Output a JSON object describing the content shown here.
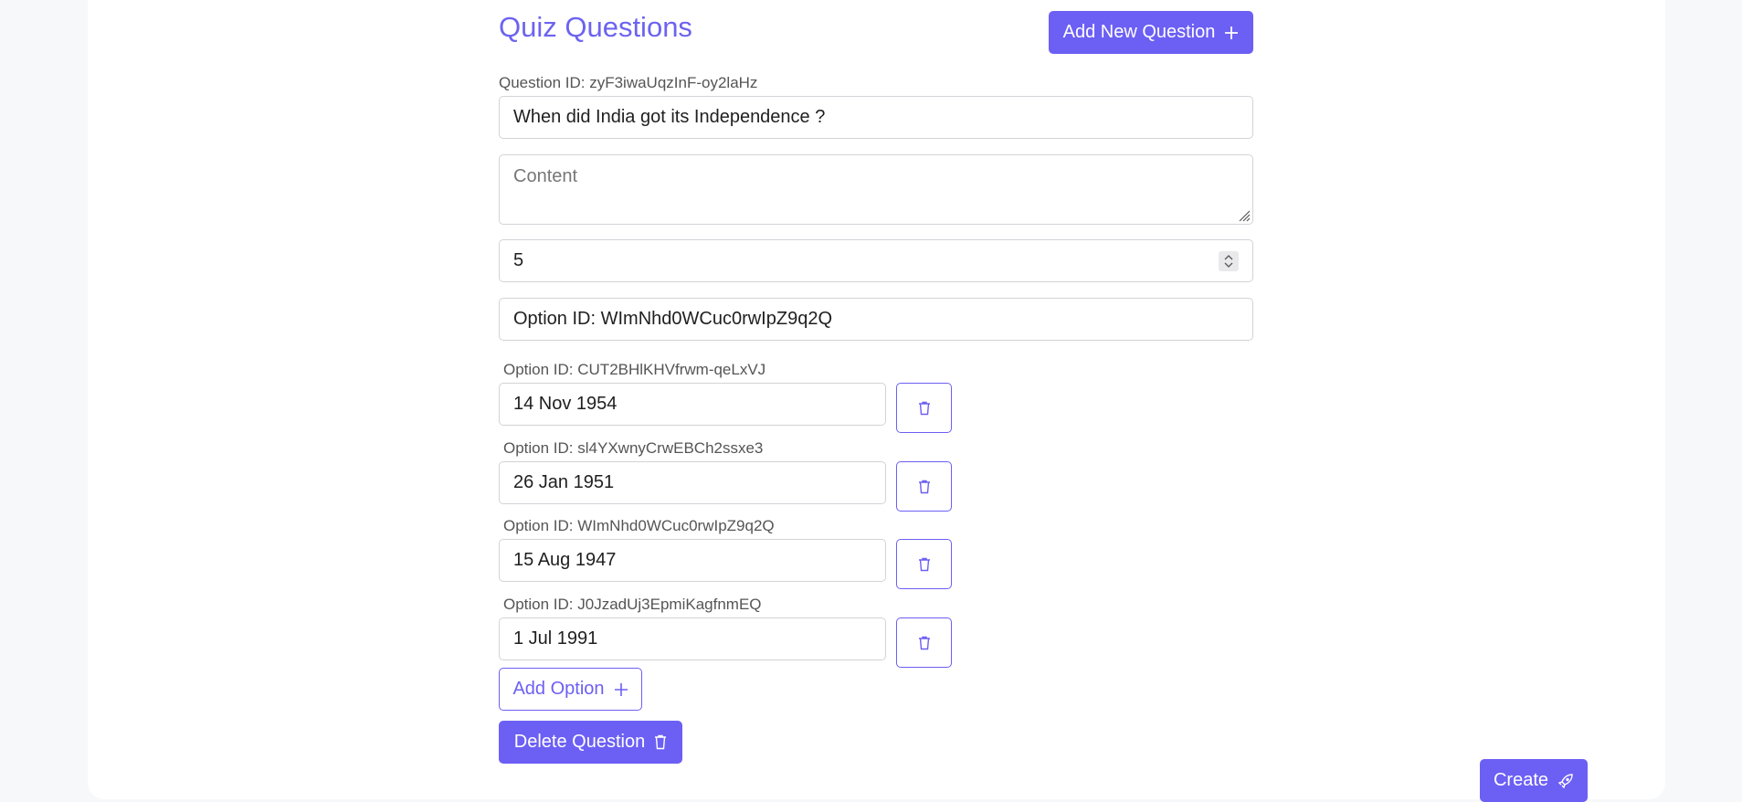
{
  "header": {
    "title": "Quiz Questions",
    "add_question_label": "Add New Question"
  },
  "question": {
    "id_label": "Question ID: zyF3iwaUqzInF-oy2laHz",
    "text_value": "When did India got its Independence ?",
    "content_placeholder": "Content",
    "points_value": "5",
    "correct_option_value": "Option ID: WImNhd0WCuc0rwIpZ9q2Q"
  },
  "options": [
    {
      "id_label": "Option ID: CUT2BHlKHVfrwm-qeLxVJ",
      "value": "14 Nov 1954"
    },
    {
      "id_label": "Option ID: sl4YXwnyCrwEBCh2ssxe3",
      "value": "26 Jan 1951"
    },
    {
      "id_label": "Option ID: WImNhd0WCuc0rwIpZ9q2Q",
      "value": "15 Aug 1947"
    },
    {
      "id_label": "Option ID: J0JzadUj3EpmiKagfnmEQ",
      "value": "1 Jul 1991"
    }
  ],
  "actions": {
    "add_option_label": "Add Option",
    "delete_question_label": "Delete Question",
    "create_label": "Create"
  },
  "colors": {
    "accent": "#6c5ff4",
    "title": "#6c63f0"
  },
  "icons": {
    "add": "plus-icon",
    "trash": "trash-icon",
    "create": "rocket-icon"
  }
}
